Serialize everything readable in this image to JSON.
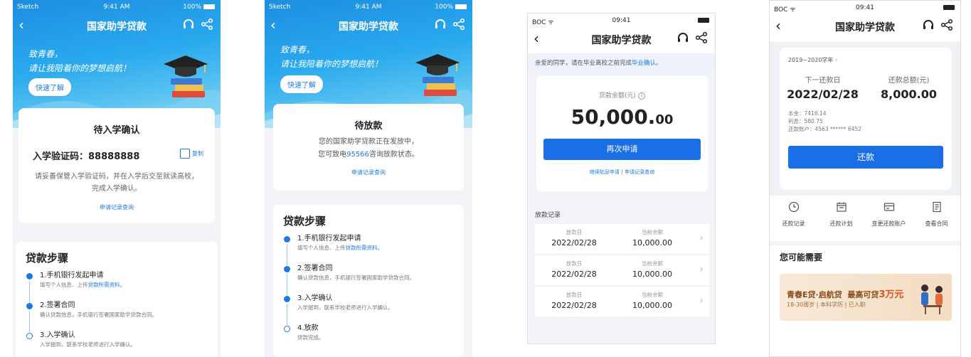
{
  "s1": {
    "status": {
      "carrier": "Sketch",
      "time": "9:41 AM",
      "battery": "100%"
    },
    "nav": {
      "title": "国家助学贷款"
    },
    "hero": {
      "line1": "致青春，",
      "line2": "请让我陪着你的梦想启航！",
      "quick_label": "快速了解"
    },
    "card": {
      "title": "待入学确认",
      "code_label": "入学验证码：",
      "code_value": "88888888",
      "copy_label": "复制",
      "desc": "请妥善保管入学验证码，并在入学后交至就读高校，完成入学确认。",
      "link": "申请记录查询"
    },
    "steps": {
      "title": "贷款步骤",
      "items": [
        {
          "title": "1.手机银行发起申请",
          "desc": "填写个人信息、上传",
          "desc_link": "贷款所需资料。"
        },
        {
          "title": "2.签署合同",
          "desc": "确认贷款信息，手机银行签署国家助学贷款合同。",
          "desc_link": ""
        },
        {
          "title": "3.入学确认",
          "desc": "入学报到，联系学校老师进行入学确认。",
          "desc_link": ""
        }
      ]
    }
  },
  "s2": {
    "status": {
      "carrier": "Sketch",
      "time": "9:41 AM",
      "battery": "100%"
    },
    "nav": {
      "title": "国家助学贷款"
    },
    "hero": {
      "line1": "致青春，",
      "line2": "请让我陪着你的梦想启航！",
      "quick_label": "快速了解"
    },
    "card": {
      "title": "待放款",
      "desc1": "您的国家助学贷款正在发放中，",
      "desc2_pre": "您可致电",
      "desc2_phone": "95566",
      "desc2_post": "咨询放款状态。",
      "link": "申请记录查询"
    },
    "steps": {
      "title": "贷款步骤",
      "items": [
        {
          "title": "1.手机银行发起申请",
          "desc": "填写个人信息、上传",
          "desc_link": "贷款所需资料。"
        },
        {
          "title": "2.签署合同",
          "desc": "确认贷款信息，手机银行签署国家助学贷款合同。",
          "desc_link": ""
        },
        {
          "title": "3.入学确认",
          "desc": "入学报到，联系学校老师进行入学确认。",
          "desc_link": ""
        },
        {
          "title": "4.放款",
          "desc": "贷款完成。",
          "desc_link": ""
        }
      ]
    }
  },
  "s3": {
    "status": {
      "carrier": "BOC",
      "time": "09:41"
    },
    "nav": {
      "title": "国家助学贷款"
    },
    "notice_pre": "亲爱的同学，请在毕业离校之前完成",
    "notice_link": "毕业确认。",
    "balance_label": "贷款余额(元)",
    "balance_int": "50,000.",
    "balance_dec": "00",
    "reapply": "再次申请",
    "link1": "继续贴息申请",
    "link_sep": "|",
    "link2": "申请记录查询",
    "records_title": "放款记录",
    "col1": "放款日",
    "col2": "当前余额",
    "records": [
      {
        "date": "2022/02/28",
        "amount": "10,000.00"
      },
      {
        "date": "2022/02/28",
        "amount": "10,000.00"
      },
      {
        "date": "2022/02/28",
        "amount": "10,000.00"
      }
    ]
  },
  "s4": {
    "status": {
      "carrier": "BOC",
      "time": "09:41"
    },
    "nav": {
      "title": "国家助学贷款"
    },
    "year": "2019~2020学年",
    "next_label": "下一还款日",
    "next_value": "2022/02/28",
    "total_label": "还款总额(元)",
    "total_value": "8,000.00",
    "principal": "本金：7416.14",
    "interest": "利息：580.75",
    "account": "还款账户：4563 ****** 6452",
    "repay": "还款",
    "actions": [
      "还款记录",
      "还款计划",
      "变更还款账户",
      "查看合同"
    ],
    "maybe_title": "您可能需要",
    "promo_title": "青春E贷·启航贷",
    "promo_max_pre": "最高可贷",
    "promo_max_num": "3万元",
    "promo_sub": "18-30周岁 | 本科学历 | 已入职"
  }
}
